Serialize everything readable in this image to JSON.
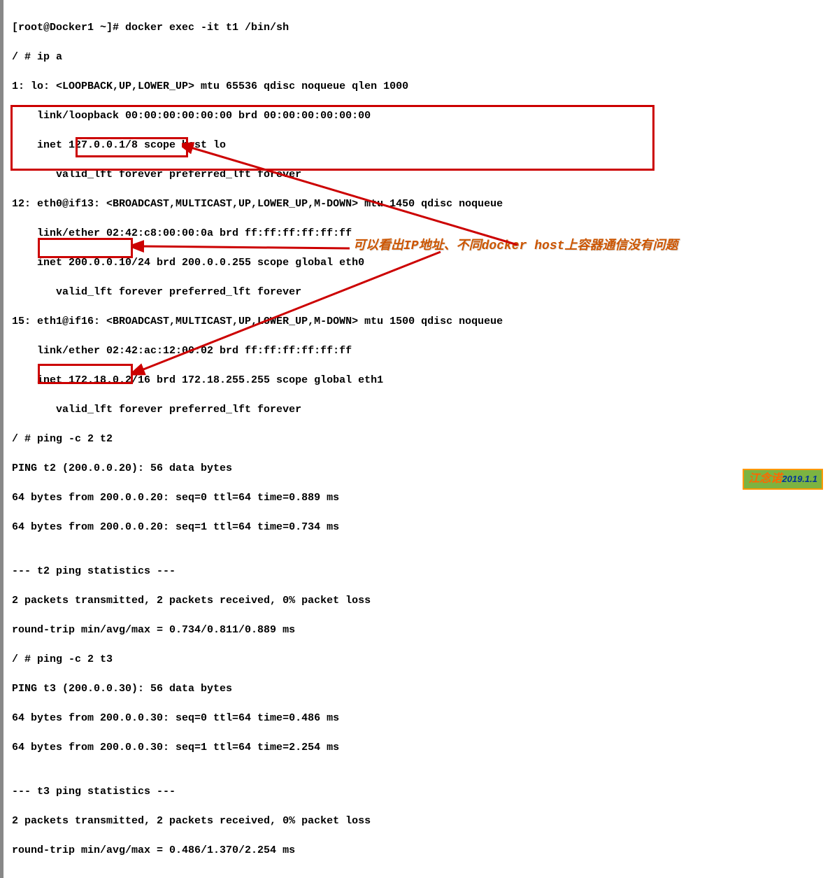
{
  "terminal": {
    "lines": [
      "[root@Docker1 ~]# docker exec -it t1 /bin/sh",
      "/ # ip a",
      "1: lo: <LOOPBACK,UP,LOWER_UP> mtu 65536 qdisc noqueue qlen 1000",
      "    link/loopback 00:00:00:00:00:00 brd 00:00:00:00:00:00",
      "    inet 127.0.0.1/8 scope host lo",
      "       valid_lft forever preferred_lft forever",
      "12: eth0@if13: <BROADCAST,MULTICAST,UP,LOWER_UP,M-DOWN> mtu 1450 qdisc noqueue",
      "    link/ether 02:42:c8:00:00:0a brd ff:ff:ff:ff:ff:ff",
      "    inet 200.0.0.10/24 brd 200.0.0.255 scope global eth0",
      "       valid_lft forever preferred_lft forever",
      "15: eth1@if16: <BROADCAST,MULTICAST,UP,LOWER_UP,M-DOWN> mtu 1500 qdisc noqueue",
      "    link/ether 02:42:ac:12:00:02 brd ff:ff:ff:ff:ff:ff",
      "    inet 172.18.0.2/16 brd 172.18.255.255 scope global eth1",
      "       valid_lft forever preferred_lft forever",
      "/ # ping -c 2 t2",
      "PING t2 (200.0.0.20): 56 data bytes",
      "64 bytes from 200.0.0.20: seq=0 ttl=64 time=0.889 ms",
      "64 bytes from 200.0.0.20: seq=1 ttl=64 time=0.734 ms",
      "",
      "--- t2 ping statistics ---",
      "2 packets transmitted, 2 packets received, 0% packet loss",
      "round-trip min/avg/max = 0.734/0.811/0.889 ms",
      "/ # ping -c 2 t3",
      "PING t3 (200.0.0.30): 56 data bytes",
      "64 bytes from 200.0.0.30: seq=0 ttl=64 time=0.486 ms",
      "64 bytes from 200.0.0.30: seq=1 ttl=64 time=2.254 ms",
      "",
      "--- t3 ping statistics ---",
      "2 packets transmitted, 2 packets received, 0% packet loss",
      "round-trip min/avg/max = 0.486/1.370/2.254 ms"
    ]
  },
  "annotation": {
    "text": "可以看出IP地址、不同docker host上容器通信没有问题"
  },
  "watermark": {
    "name": "江念诺",
    "date": "2019.1.1"
  },
  "highlights": {
    "ip_address": "200.0.0.10/24",
    "ping_cmd_t2": "ping -c 2 t2",
    "ping_cmd_t3": "ping -c 2 t3"
  }
}
